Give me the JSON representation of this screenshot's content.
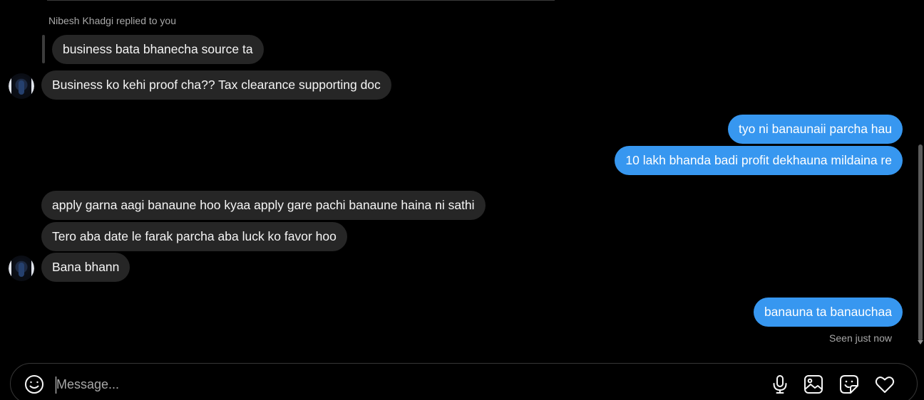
{
  "thread": {
    "reply_meta": "Nibesh Khadgi replied to you",
    "messages": [
      {
        "text": "business bata bhanecha source ta",
        "direction": "incoming",
        "is_quoted_reply": true
      },
      {
        "text": "Business ko kehi proof cha?? Tax clearance supporting doc",
        "direction": "incoming",
        "show_avatar": true
      },
      {
        "text": "tyo ni banaunaii parcha hau",
        "direction": "outgoing"
      },
      {
        "text": "10 lakh bhanda badi profit dekhauna mildaina re",
        "direction": "outgoing"
      },
      {
        "text": "apply garna aagi banaune hoo kyaa apply gare pachi banaune haina ni sathi",
        "direction": "incoming"
      },
      {
        "text": "Tero aba date le farak parcha aba luck ko favor hoo",
        "direction": "incoming"
      },
      {
        "text": "Bana bhann",
        "direction": "incoming",
        "show_avatar": true
      },
      {
        "text": "banauna ta banauchaa",
        "direction": "outgoing"
      }
    ],
    "seen_status": "Seen just now"
  },
  "composer": {
    "placeholder": "Message...",
    "value": "",
    "icons": [
      "emoji-icon",
      "microphone-icon",
      "image-icon",
      "sticker-icon",
      "heart-icon"
    ]
  },
  "colors": {
    "background": "#000000",
    "incoming_bubble": "#262626",
    "outgoing_bubble": "#3797f0",
    "muted_text": "#a8a8a8"
  }
}
